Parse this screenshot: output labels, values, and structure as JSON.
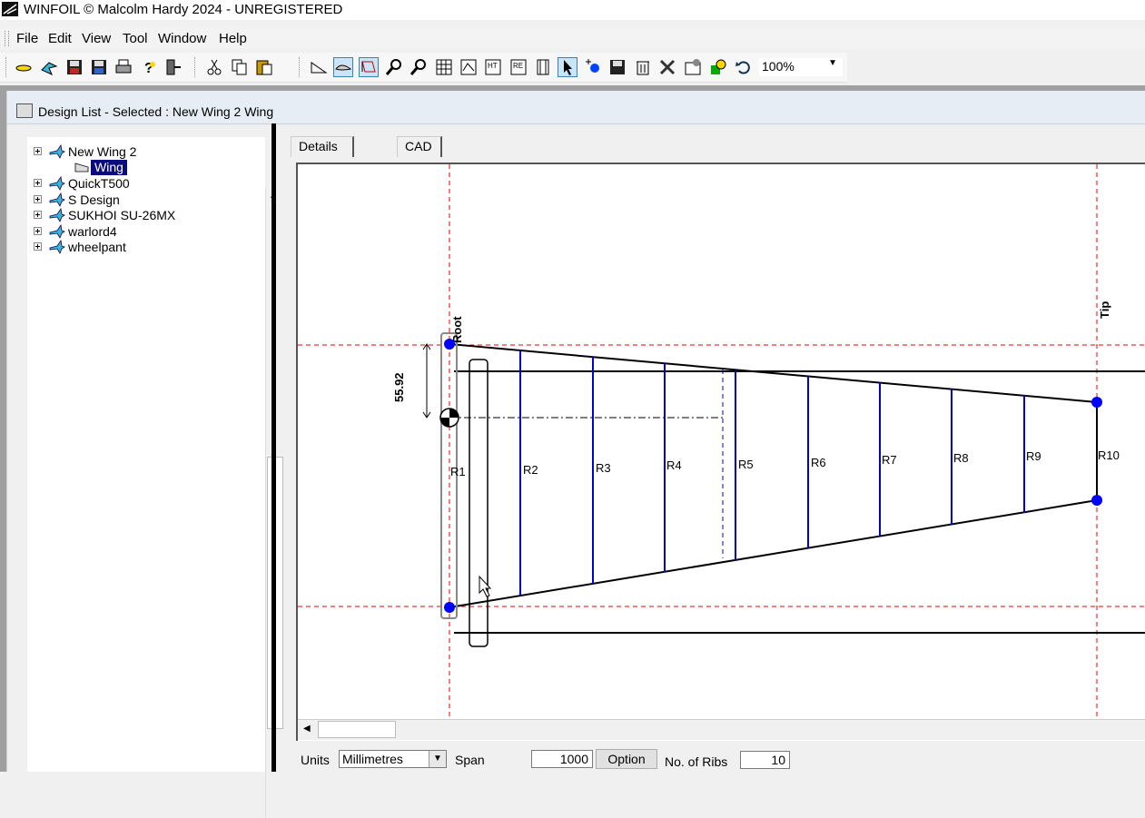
{
  "window": {
    "title": "WINFOIL © Malcolm Hardy 2024 - UNREGISTERED"
  },
  "menu": [
    "File",
    "Edit",
    "View",
    "Tool",
    "Window",
    "Help"
  ],
  "toolbar": {
    "zoom_value": "100%",
    "buttons": [
      "new-icon",
      "wizard-icon",
      "save-icon",
      "save-all-icon",
      "print-icon",
      "help-icon",
      "exit-icon",
      "cut-icon",
      "copy-icon",
      "paste-icon",
      "wing-plan-icon",
      "airfoil-icon",
      "rib-icon",
      "zoom-in-icon",
      "zoom-out-icon",
      "grid-icon",
      "cad-rib-icon",
      "cad-spar-icon",
      "cad-rib-export-icon",
      "film-icon",
      "pointer-icon",
      "add-point-icon",
      "save-drawing-icon",
      "delete-icon",
      "tools-icon",
      "properties-icon",
      "layers-icon",
      "undo-icon"
    ]
  },
  "child_window": {
    "title": "Design List - Selected : New Wing 2 Wing"
  },
  "tree": {
    "items": [
      {
        "label": "New Wing 2",
        "icon": "plane-icon"
      },
      {
        "label": "Wing",
        "icon": "wing-icon",
        "selected": true
      },
      {
        "label": "QuickT500",
        "icon": "plane-icon"
      },
      {
        "label": "S Design",
        "icon": "plane-icon"
      },
      {
        "label": "SUKHOI SU-26MX",
        "icon": "plane-icon"
      },
      {
        "label": "warlord4",
        "icon": "plane-icon"
      },
      {
        "label": "wheelpant",
        "icon": "plane-icon"
      }
    ]
  },
  "tabs": [
    "Details",
    "CAD"
  ],
  "cad": {
    "dimension": "55.92",
    "root_label": "Root",
    "tip_label": "Tip",
    "ribs": [
      "R1",
      "R2",
      "R3",
      "R4",
      "R5",
      "R6",
      "R7",
      "R8",
      "R9",
      "R10"
    ]
  },
  "bottom": {
    "units_label": "Units",
    "units_value": "Millimetres",
    "span_label": "Span",
    "span_value": "1000",
    "option_button": "Option",
    "ribs_label": "No. of Ribs",
    "ribs_value": "10"
  }
}
